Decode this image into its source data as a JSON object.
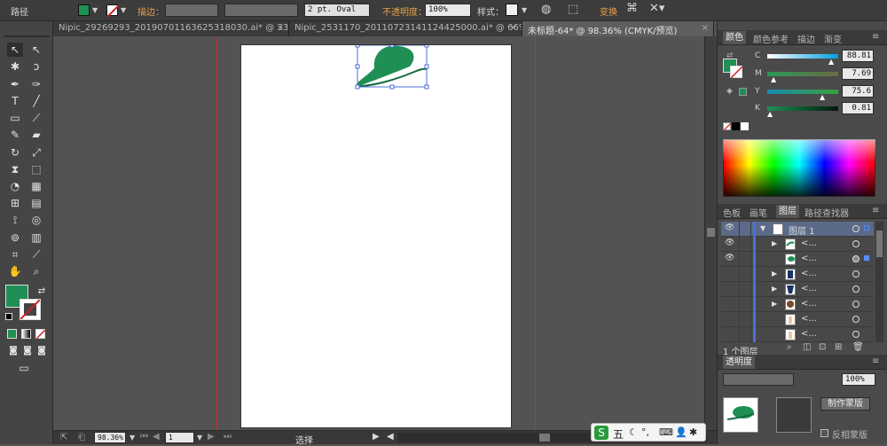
{
  "control_bar": {
    "object_type": "路径",
    "stroke_label": "描边：",
    "brush_value": "2 pt. Oval",
    "opacity_label": "不透明度：",
    "opacity_value": "100%",
    "style_label": "样式：",
    "transform_label": "变换",
    "fill_color": "#1f8f55"
  },
  "tabs": [
    {
      "label": "Nipic_29269293_20190701163625318030.ai* @ 33...",
      "close": "×"
    },
    {
      "label": "Nipic_2531170_20110723141124425000.ai* @ 66%...",
      "close": "×"
    },
    {
      "label": "未标题-64* @ 98.36% (CMYK/预览)",
      "close": "×"
    }
  ],
  "status_bar": {
    "zoom": "98.36%",
    "artboard": "1",
    "mode": "选择"
  },
  "color_panel": {
    "tabs": [
      "颜色",
      "颜色参考",
      "描边",
      "渐变"
    ],
    "channels": [
      {
        "label": "C",
        "value": "88.81",
        "color": "#00a0e0"
      },
      {
        "label": "M",
        "value": "7.69",
        "color": "#e0007a"
      },
      {
        "label": "Y",
        "value": "75.6",
        "color": "#f0e000"
      },
      {
        "label": "K",
        "value": "0.81",
        "color": "#202020"
      }
    ]
  },
  "layers_panel": {
    "tabs": [
      "色板",
      "画笔",
      "图层",
      "路径查找器"
    ],
    "layer_name": "图层 1",
    "item_label": "<...",
    "footer": "1 个图层",
    "rows": [
      {
        "name": "图层 1",
        "expanded": true,
        "visible": true,
        "selected": true
      },
      {
        "name": "<...",
        "expanded": false,
        "visible": true,
        "selected": false,
        "thumb_color": "#1f8f55"
      },
      {
        "name": "<...",
        "expanded": false,
        "visible": true,
        "selected": false,
        "thumb_color": "#1f8f55"
      },
      {
        "name": "<...",
        "expanded": false,
        "visible": false,
        "selected": false,
        "thumb_color": "#1a3366"
      },
      {
        "name": "<...",
        "expanded": false,
        "visible": false,
        "selected": false,
        "thumb_color": "#1a3366"
      },
      {
        "name": "<...",
        "expanded": false,
        "visible": false,
        "selected": false,
        "thumb_color": "#7a4a2a"
      },
      {
        "name": "<...",
        "expanded": false,
        "visible": false,
        "selected": false,
        "thumb_color": "#e8c8a8"
      },
      {
        "name": "<...",
        "expanded": false,
        "visible": false,
        "selected": false,
        "thumb_color": "#e8c8a8"
      }
    ]
  },
  "transparency_panel": {
    "title": "透明度",
    "opacity_value": "100%",
    "make_mask_label": "制作蒙版",
    "invert_mask_label": "反相蒙版"
  },
  "ime_bar": {
    "text": "五"
  }
}
